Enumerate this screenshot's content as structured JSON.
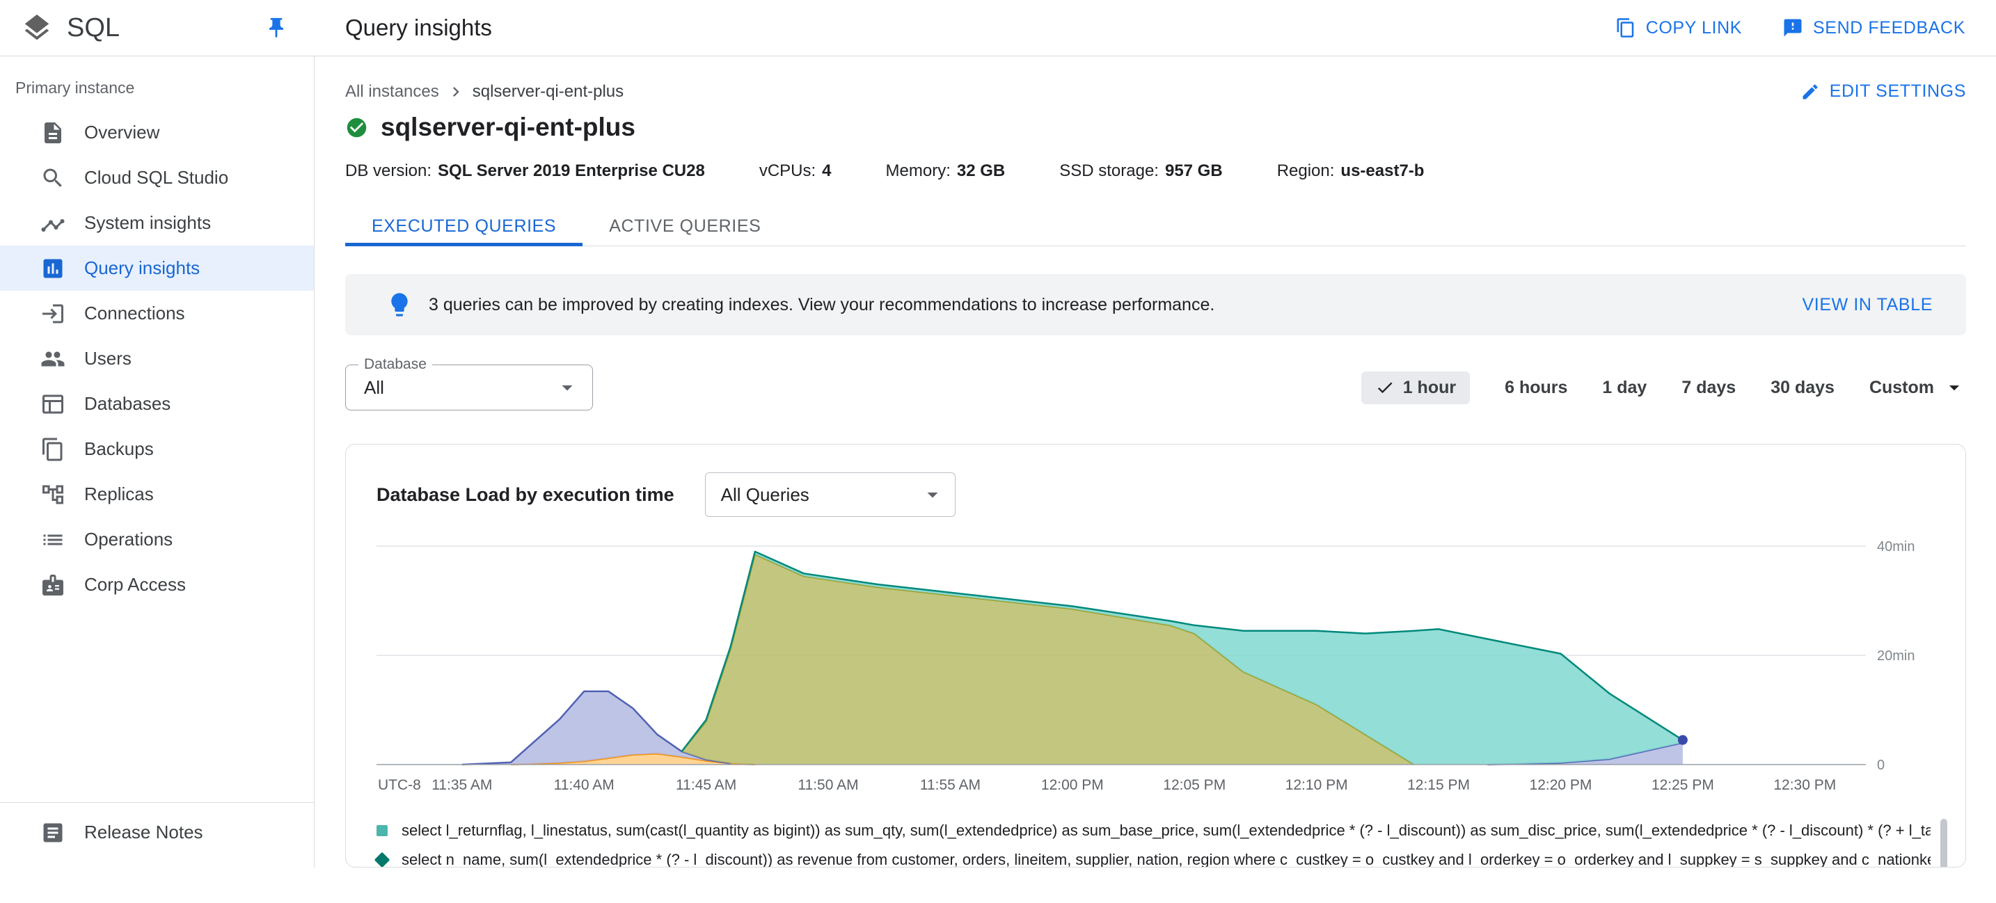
{
  "colors": {
    "accent": "#1a73e8",
    "active_tab": "#1967d2",
    "active_nav_bg": "#e8f0fe",
    "banner_bg": "#f1f3f4",
    "border": "#dadce0",
    "success_green": "#1e8e3e"
  },
  "header": {
    "app_name": "SQL",
    "page_title": "Query insights",
    "copy_link": "COPY LINK",
    "send_feedback": "SEND FEEDBACK"
  },
  "sidebar": {
    "section_label": "Primary instance",
    "items": [
      {
        "label": "Overview",
        "icon": "overview-icon",
        "active": false
      },
      {
        "label": "Cloud SQL Studio",
        "icon": "sql-studio-icon",
        "active": false
      },
      {
        "label": "System insights",
        "icon": "system-insights-icon",
        "active": false
      },
      {
        "label": "Query insights",
        "icon": "query-insights-icon",
        "active": true
      },
      {
        "label": "Connections",
        "icon": "connections-icon",
        "active": false
      },
      {
        "label": "Users",
        "icon": "users-icon",
        "active": false
      },
      {
        "label": "Databases",
        "icon": "databases-icon",
        "active": false
      },
      {
        "label": "Backups",
        "icon": "backups-icon",
        "active": false
      },
      {
        "label": "Replicas",
        "icon": "replicas-icon",
        "active": false
      },
      {
        "label": "Operations",
        "icon": "operations-icon",
        "active": false
      },
      {
        "label": "Corp Access",
        "icon": "corp-access-icon",
        "active": false
      }
    ],
    "footer": [
      {
        "label": "Release Notes",
        "icon": "release-notes-icon",
        "active": false
      }
    ]
  },
  "breadcrumb": {
    "parent": "All instances",
    "current": "sqlserver-qi-ent-plus"
  },
  "instance": {
    "name": "sqlserver-qi-ent-plus",
    "edit_settings": "EDIT SETTINGS",
    "meta": [
      {
        "label": "DB version:",
        "value": "SQL Server 2019 Enterprise CU28"
      },
      {
        "label": "vCPUs:",
        "value": "4"
      },
      {
        "label": "Memory:",
        "value": "32 GB"
      },
      {
        "label": "SSD storage:",
        "value": "957 GB"
      },
      {
        "label": "Region:",
        "value": "us-east7-b"
      }
    ]
  },
  "tabs": [
    {
      "label": "EXECUTED QUERIES",
      "active": true
    },
    {
      "label": "ACTIVE QUERIES",
      "active": false
    }
  ],
  "banner": {
    "text": "3 queries can be improved by creating indexes. View your recommendations to increase performance.",
    "action": "VIEW IN TABLE"
  },
  "filters": {
    "database": {
      "label": "Database",
      "value": "All"
    },
    "time_ranges": [
      {
        "label": "1 hour",
        "selected": true
      },
      {
        "label": "6 hours"
      },
      {
        "label": "1 day"
      },
      {
        "label": "7 days"
      },
      {
        "label": "30 days"
      },
      {
        "label": "Custom",
        "dropdown": true
      }
    ]
  },
  "chart_card": {
    "title": "Database Load by execution time",
    "query_filter_value": "All Queries",
    "legend": [
      {
        "marker": "square",
        "color": "#4db6ac",
        "text": "select l_returnflag, l_linestatus, sum(cast(l_quantity as bigint)) as sum_qty, sum(l_extendedprice) as sum_base_price, sum(l_extendedprice * (? - l_discount)) as sum_disc_price, sum(l_extendedprice * (? - l_discount) * (? + l_tax)) ..."
      },
      {
        "marker": "diamond",
        "color": "#00796b",
        "text": "select n_name, sum(l_extendedprice * (? - l_discount)) as revenue from customer, orders, lineitem, supplier, nation, region where c_custkey = o_custkey and l_orderkey = o_orderkey and l_suppkey = s_suppkey and c_nationkey = s..."
      }
    ]
  },
  "chart_data": {
    "type": "area",
    "stacked": true,
    "title": "Database Load by execution time",
    "x_unit": "minutes after 11:35 AM",
    "y_unit": "minutes of db load",
    "x_domain": [
      -3.5,
      57.5
    ],
    "ylim": [
      0,
      42
    ],
    "timezone_label": "UTC-8",
    "x": [
      -3.5,
      0,
      2,
      4,
      5,
      6,
      7,
      8,
      9,
      10,
      11,
      12,
      14,
      17,
      20,
      25,
      29,
      30,
      32,
      35,
      37,
      39,
      40,
      42,
      45,
      47,
      50
    ],
    "series": [
      {
        "name": "query-orange",
        "color": "#fb8c00",
        "fill": "#ffcc80",
        "values": [
          0,
          0,
          0,
          0.3,
          0.6,
          1.2,
          1.8,
          2,
          1.4,
          0.7,
          0.2,
          0,
          0,
          0,
          0,
          0,
          0,
          0,
          0,
          0,
          0,
          0,
          0,
          0,
          0,
          0,
          0
        ]
      },
      {
        "name": "query-indigo",
        "color": "#5061b5",
        "fill": "#b3bae2",
        "values": [
          0,
          0,
          0.4,
          8,
          12.8,
          12.2,
          8.5,
          3.5,
          1,
          0.2,
          0,
          0,
          0,
          0,
          0,
          0,
          0,
          0,
          0,
          0,
          0,
          0,
          0,
          0,
          0.3,
          1,
          4
        ]
      },
      {
        "name": "query-olive",
        "color": "#9e9d24",
        "fill": "#b9bc69",
        "values": [
          0,
          0,
          0,
          0,
          0,
          0,
          0,
          0,
          0,
          7,
          21,
          38.5,
          34.5,
          32.5,
          31,
          28.5,
          25.5,
          24,
          17,
          11,
          5.5,
          0,
          0,
          0,
          0,
          0,
          0
        ]
      },
      {
        "name": "query-teal",
        "color": "#00897b",
        "fill": "#80d8d0",
        "values": [
          0,
          0,
          0,
          0,
          0,
          0,
          0,
          0,
          0,
          0.3,
          0.4,
          0.5,
          0.5,
          0.5,
          0.5,
          0.5,
          0.8,
          1.5,
          7.5,
          13.5,
          18.5,
          24.5,
          24.8,
          23,
          20,
          12,
          0.5
        ]
      }
    ],
    "x_ticks": [
      {
        "t": 0,
        "label": "11:35 AM"
      },
      {
        "t": 5,
        "label": "11:40 AM"
      },
      {
        "t": 10,
        "label": "11:45 AM"
      },
      {
        "t": 15,
        "label": "11:50 AM"
      },
      {
        "t": 20,
        "label": "11:55 AM"
      },
      {
        "t": 25,
        "label": "12:00 PM"
      },
      {
        "t": 30,
        "label": "12:05 PM"
      },
      {
        "t": 35,
        "label": "12:10 PM"
      },
      {
        "t": 40,
        "label": "12:15 PM"
      },
      {
        "t": 45,
        "label": "12:20 PM"
      },
      {
        "t": 50,
        "label": "12:25 PM"
      },
      {
        "t": 55,
        "label": "12:30 PM"
      }
    ],
    "y_ticks": [
      {
        "value": 40,
        "label": "40min"
      },
      {
        "value": 20,
        "label": "20min"
      },
      {
        "value": 0,
        "label": "0"
      }
    ],
    "end_marker": {
      "x": 50,
      "y": 4.5,
      "color": "#3949ab"
    }
  }
}
